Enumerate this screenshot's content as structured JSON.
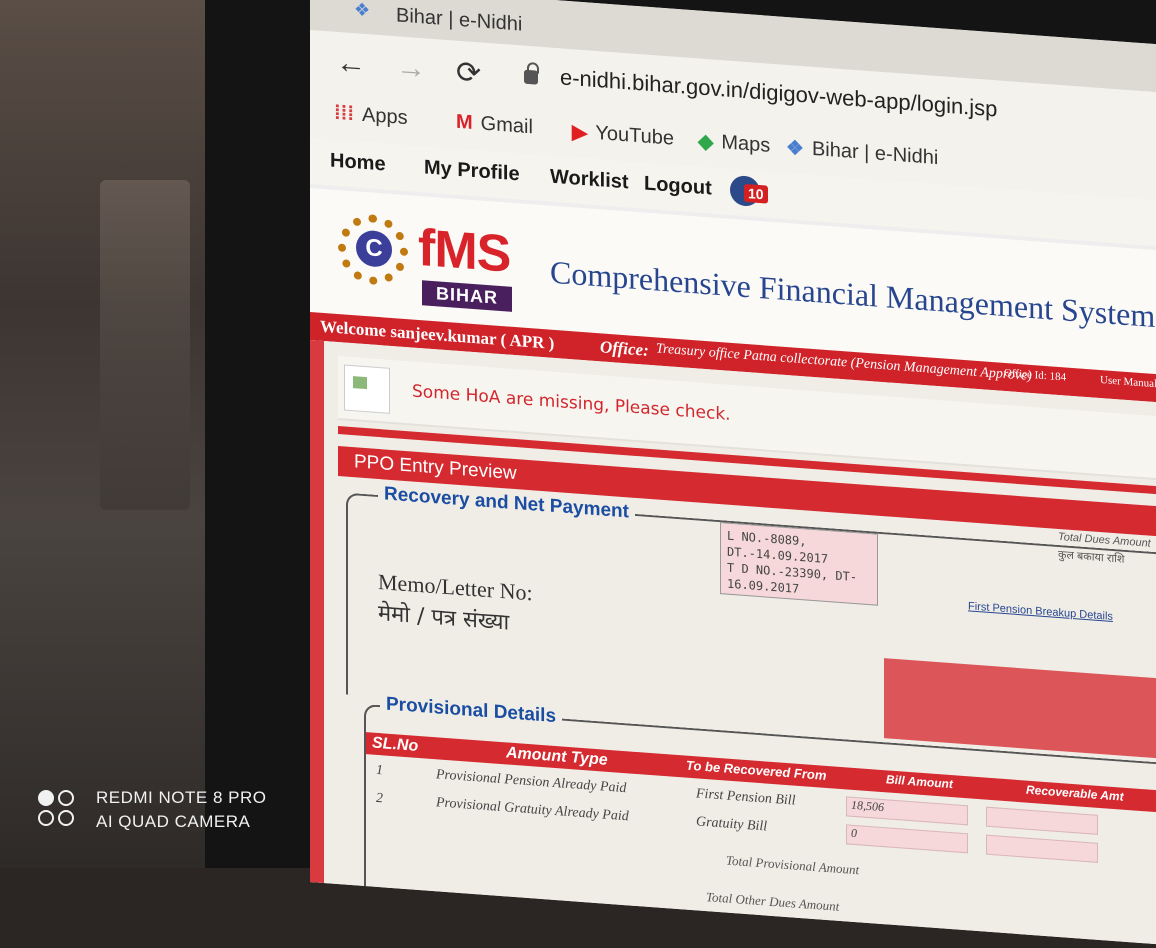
{
  "browser": {
    "tab_title": "Bihar | e-Nidhi",
    "tab_close": "×",
    "tab_new": "+",
    "nav_back": "←",
    "nav_forward": "→",
    "nav_reload": "⟳",
    "url": "e-nidhi.bihar.gov.in/digigov-web-app/login.jsp",
    "bookmarks": [
      {
        "label": "Apps",
        "icon": "apps-grid-icon",
        "glyph": "⁞⁞⁞",
        "color": "#d83a3f"
      },
      {
        "label": "Gmail",
        "icon": "gmail-icon",
        "glyph": "M",
        "color": "#d8232a"
      },
      {
        "label": "YouTube",
        "icon": "youtube-icon",
        "glyph": "▶",
        "color": "#e02020"
      },
      {
        "label": "Maps",
        "icon": "maps-icon",
        "glyph": "◆",
        "color": "#2ea84a"
      },
      {
        "label": "Bihar | e-Nidhi",
        "icon": "enidhi-favicon-icon",
        "glyph": "❖",
        "color": "#4a7fd0"
      }
    ]
  },
  "app_nav": {
    "home": "Home",
    "my_profile": "My Profile",
    "worklist": "Worklist",
    "logout": "Logout",
    "notification_count": "10"
  },
  "header": {
    "logo_letter": "C",
    "logo_fms": "fMS",
    "logo_state": "BIHAR",
    "title": "Comprehensive Financial Management System"
  },
  "welcome_bar": {
    "welcome": "Welcome sanjeev.kumar ( APR )",
    "office_label": "Office:",
    "office": "Treasury office Patna collectorate (Pension Management Approve)",
    "office_id": "Office Id: 184",
    "user_manual": "User Manual"
  },
  "alert": {
    "message": "Some HoA are missing, Please check."
  },
  "panel": {
    "title": "PPO Entry Preview",
    "recovery_legend": "Recovery and Net Payment",
    "memo_label": "Memo/Letter No:",
    "memo_label_hindi": "मेमो / पत्र संख्या",
    "memo_value": "L NO.-8089,\nDT.-14.09.2017\nT D NO.-23390, DT-\n16.09.2017",
    "total_dues_label": "Total Dues Amount",
    "total_dues_hindi": "कुल बकाया राशि",
    "pension_breakup_link": "First Pension Breakup Details"
  },
  "provisional": {
    "legend": "Provisional Details",
    "columns": [
      "SL.No",
      "Amount Type",
      "To be Recovered From",
      "Bill Amount",
      "Recoverable Amt"
    ],
    "rows": [
      {
        "sl": "1",
        "type": "Provisional Pension Already Paid",
        "from": "First Pension Bill",
        "bill": "18,506"
      },
      {
        "sl": "2",
        "type": "Provisional Gratuity Already Paid",
        "from": "Gratuity Bill",
        "bill": "0"
      }
    ],
    "total_label": "Total Provisional Amount",
    "total_other_dues": "Total Other Dues Amount"
  },
  "colors": {
    "accent_red": "#d42a30",
    "title_blue": "#27468f",
    "legend_blue": "#1b4ea3"
  },
  "watermark": {
    "line1": "REDMI NOTE 8 PRO",
    "line2": "AI QUAD CAMERA"
  }
}
